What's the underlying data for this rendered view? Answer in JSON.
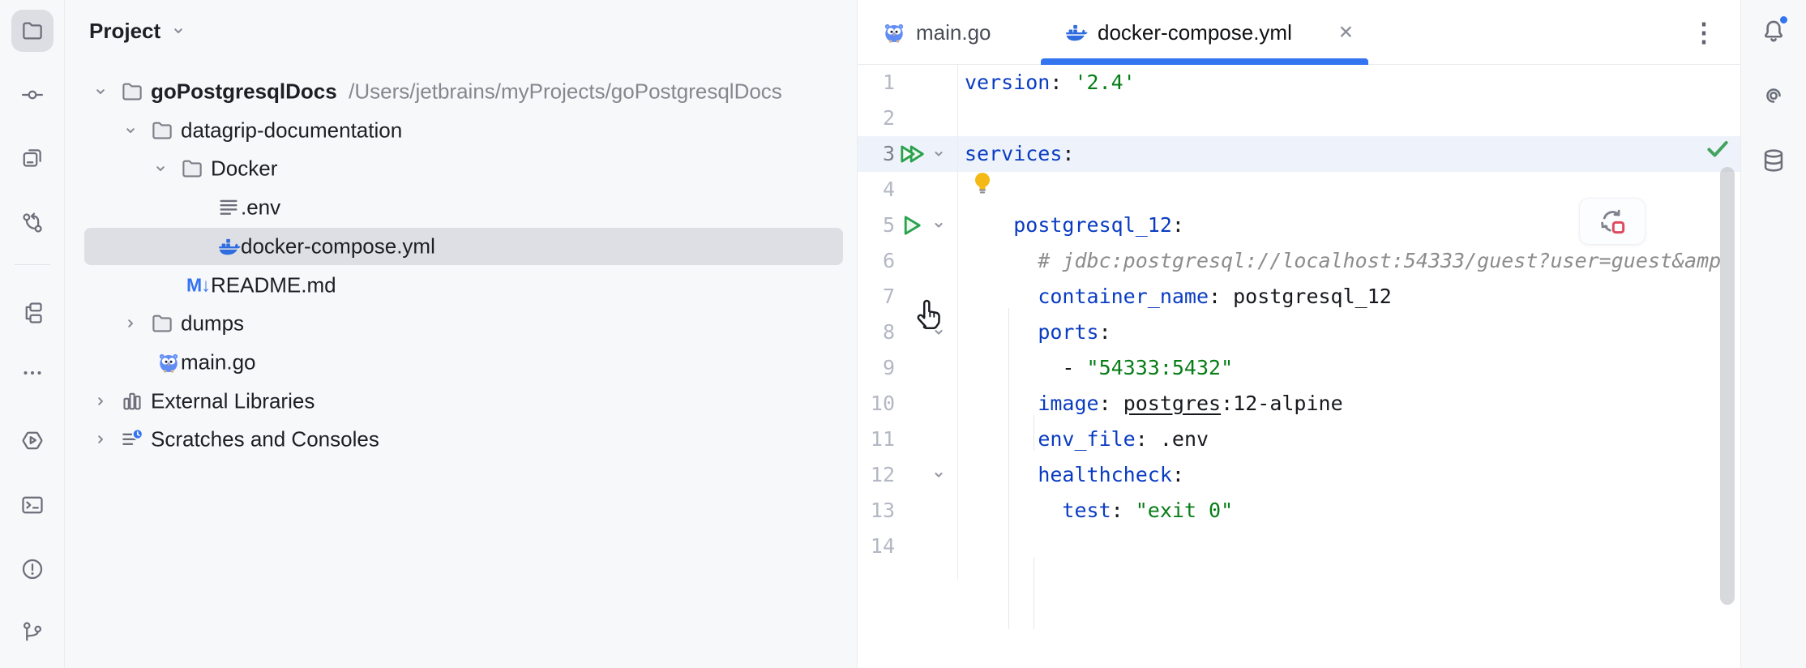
{
  "colors": {
    "accent": "#3574f0",
    "panel_bg": "#f7f8fa",
    "border": "#ebecf0",
    "selection": "#dddfe4",
    "icon": "#6b6f7a",
    "yaml_key": "#0a3cc2",
    "string_green": "#067d17",
    "comment_gray": "#8c8c8c",
    "run_green": "#2aa14c",
    "stop_red": "#e04a5f",
    "line_highlight": "#eef3fb"
  },
  "stripe": {
    "items": [
      {
        "id": "project",
        "icon": "folder",
        "active": true
      },
      {
        "id": "commit",
        "icon": "commit"
      },
      {
        "id": "bookmarks",
        "icon": "windows"
      },
      {
        "id": "pull-requests",
        "icon": "pr",
        "divider_after": true
      },
      {
        "id": "structure",
        "icon": "structure"
      },
      {
        "id": "more-tool-windows",
        "icon": "more"
      },
      {
        "id": "services",
        "icon": "services"
      },
      {
        "id": "terminal",
        "icon": "terminal"
      },
      {
        "id": "problems",
        "icon": "problems"
      },
      {
        "id": "version-control",
        "icon": "git"
      }
    ]
  },
  "project_panel": {
    "title": "Project",
    "tree": [
      {
        "label": "goPostgresqlDocs",
        "path_suffix": "/Users/jetbrains/myProjects/goPostgresqlDocs",
        "level": 0,
        "icon": "folder",
        "chevron": "down",
        "bold": true
      },
      {
        "label": "datagrip-documentation",
        "level": 1,
        "icon": "folder",
        "chevron": "down"
      },
      {
        "label": "Docker",
        "level": 2,
        "icon": "folder",
        "chevron": "down"
      },
      {
        "label": ".env",
        "level": 3,
        "icon": "file-lines"
      },
      {
        "label": "docker-compose.yml",
        "level": 3,
        "icon": "docker",
        "selected": true
      },
      {
        "label": "README.md",
        "level": 2,
        "icon": "markdown",
        "icon_text": "M↓"
      },
      {
        "label": "dumps",
        "level": 1,
        "icon": "folder",
        "chevron": "right"
      },
      {
        "label": "main.go",
        "level": 1,
        "icon": "gopher"
      },
      {
        "label": "External Libraries",
        "level": 0,
        "icon": "library",
        "chevron": "right"
      },
      {
        "label": "Scratches and Consoles",
        "level": 0,
        "icon": "scratch",
        "chevron": "right"
      }
    ]
  },
  "editor": {
    "tabs": [
      {
        "label": "main.go",
        "icon": "gopher",
        "active": false
      },
      {
        "label": "docker-compose.yml",
        "icon": "docker",
        "active": true,
        "close_glyph": "✕"
      }
    ],
    "more_glyph": "⋮",
    "lines": [
      {
        "n": 1,
        "tokens": [
          [
            "key",
            "version"
          ],
          [
            "plain",
            ": "
          ],
          [
            "string",
            "'2.4'"
          ]
        ]
      },
      {
        "n": 2,
        "bulb": true,
        "tokens": []
      },
      {
        "n": 3,
        "gutter": "run-all",
        "highlight": true,
        "widget": true,
        "tokens": [
          [
            "key",
            "services"
          ],
          [
            "plain",
            ":"
          ]
        ]
      },
      {
        "n": 4,
        "tokens": []
      },
      {
        "n": 5,
        "gutter": "run",
        "cursor": true,
        "tokens": [
          [
            "plain",
            "    "
          ],
          [
            "key",
            "postgresql_12"
          ],
          [
            "plain",
            ":"
          ]
        ]
      },
      {
        "n": 6,
        "tokens": [
          [
            "comment",
            "      # jdbc:postgresql://localhost:54333/guest?user=guest&amp"
          ]
        ]
      },
      {
        "n": 7,
        "tokens": [
          [
            "plain",
            "      "
          ],
          [
            "key",
            "container_name"
          ],
          [
            "plain",
            ": postgresql_12"
          ]
        ]
      },
      {
        "n": 8,
        "gutter": "fold",
        "tokens": [
          [
            "plain",
            "      "
          ],
          [
            "key",
            "ports"
          ],
          [
            "plain",
            ":"
          ]
        ]
      },
      {
        "n": 9,
        "tokens": [
          [
            "plain",
            "        - "
          ],
          [
            "string",
            "\"54333:5432\""
          ]
        ]
      },
      {
        "n": 10,
        "tokens": [
          [
            "plain",
            "      "
          ],
          [
            "key",
            "image"
          ],
          [
            "plain",
            ": "
          ],
          [
            "link",
            "postgres"
          ],
          [
            "plain",
            ":12-alpine"
          ]
        ]
      },
      {
        "n": 11,
        "tokens": [
          [
            "plain",
            "      "
          ],
          [
            "key",
            "env_file"
          ],
          [
            "plain",
            ": .env"
          ]
        ]
      },
      {
        "n": 12,
        "gutter": "fold",
        "tokens": [
          [
            "plain",
            "      "
          ],
          [
            "key",
            "healthcheck"
          ],
          [
            "plain",
            ":"
          ]
        ]
      },
      {
        "n": 13,
        "tokens": [
          [
            "plain",
            "        "
          ],
          [
            "key",
            "test"
          ],
          [
            "plain",
            ": "
          ],
          [
            "string",
            "\"exit 0\""
          ]
        ]
      },
      {
        "n": 14,
        "tokens": []
      }
    ]
  },
  "right_stripe": {
    "items": [
      {
        "id": "notifications",
        "icon": "bell",
        "badge": true
      },
      {
        "id": "ai-assistant",
        "icon": "ai"
      },
      {
        "id": "database",
        "icon": "db"
      }
    ]
  }
}
